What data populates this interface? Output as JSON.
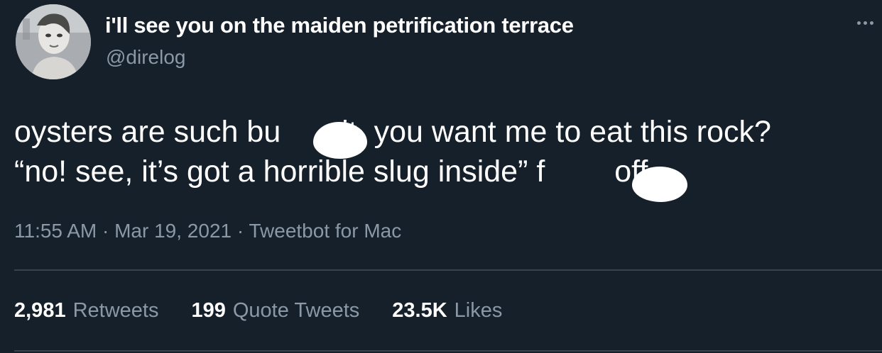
{
  "author": {
    "display_name": "i'll see you on the maiden petrification terrace",
    "handle": "@direlog",
    "avatar_icon": "user-avatar-photo"
  },
  "tweet": {
    "line_1": "oysters are such bu    it. you want me to eat this rock?",
    "line_2": "“no! see, it’s got a horrible slug inside” f     off",
    "timestamp": "11:55 AM · Mar 19, 2021 · Tweetbot for Mac"
  },
  "stats": {
    "retweets_count": "2,981",
    "retweets_label": "Retweets",
    "quotes_count": "199",
    "quotes_label": "Quote Tweets",
    "likes_count": "23.5K",
    "likes_label": "Likes"
  },
  "theme": {
    "background": "#15202b",
    "text": "#ffffff",
    "secondary_text": "#8b98a5",
    "divider": "#38444d"
  }
}
